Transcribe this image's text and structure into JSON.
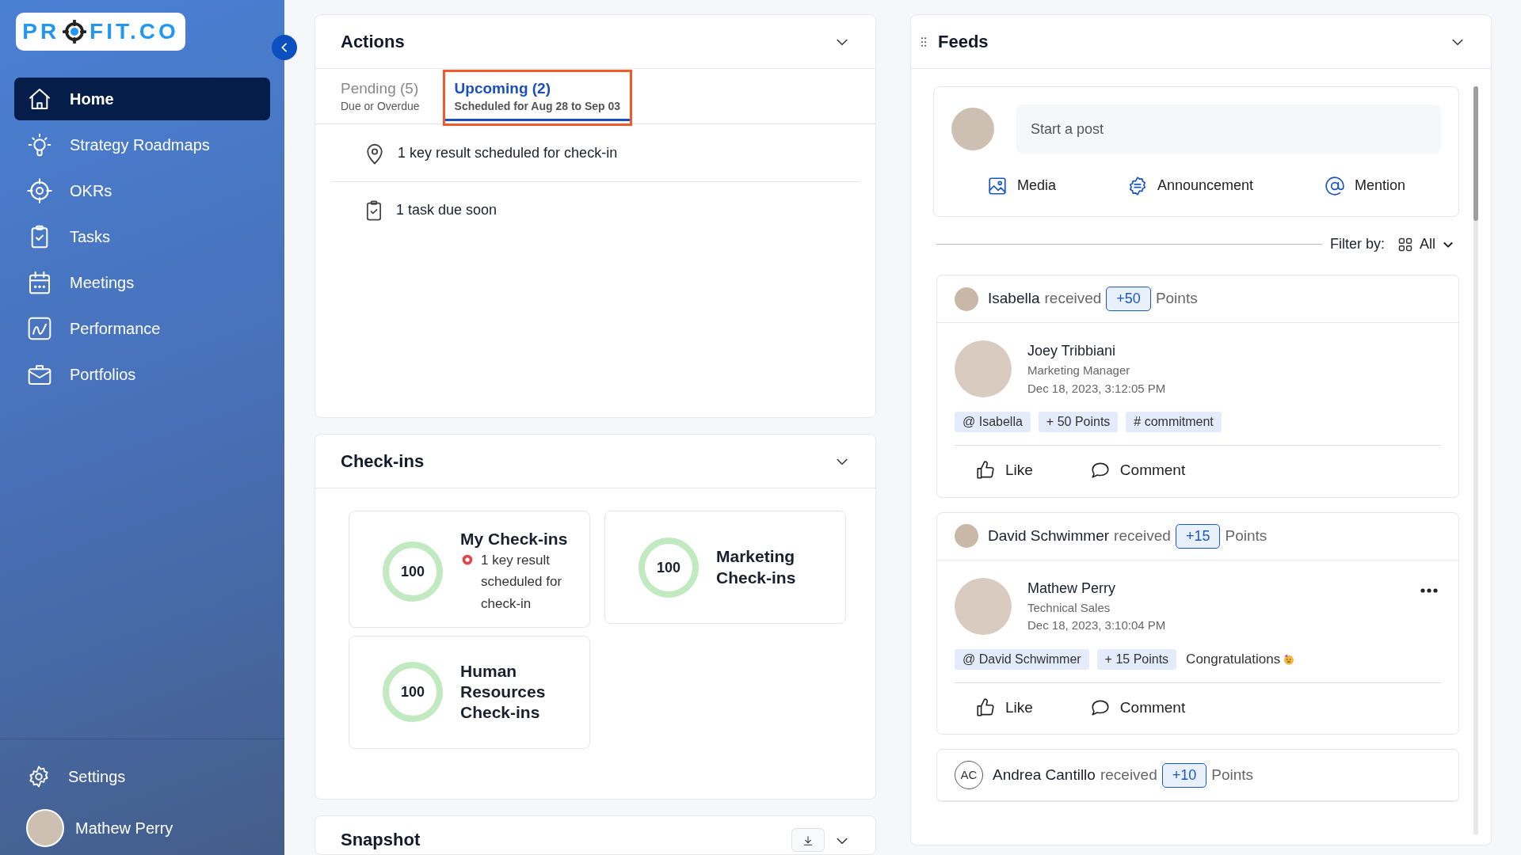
{
  "sidebar": {
    "logo": {
      "before": "PR",
      "after": "FIT.CO"
    },
    "items": [
      {
        "label": "Home",
        "kind": "home",
        "selected": true
      },
      {
        "label": "Strategy Roadmaps",
        "kind": "bulb",
        "selected": false
      },
      {
        "label": "OKRs",
        "kind": "target",
        "selected": false
      },
      {
        "label": "Tasks",
        "kind": "clipboard",
        "selected": false
      },
      {
        "label": "Meetings",
        "kind": "calendar",
        "selected": false
      },
      {
        "label": "Performance",
        "kind": "chart",
        "selected": false
      },
      {
        "label": "Portfolios",
        "kind": "briefcase",
        "selected": false
      }
    ],
    "settings": "Settings",
    "user": "Mathew Perry"
  },
  "actions": {
    "title": "Actions",
    "tabs": [
      {
        "label": "Pending (5)",
        "sub": "Due or Overdue",
        "selected": false
      },
      {
        "label": "Upcoming (2)",
        "sub": "Scheduled for Aug 28 to Sep 03",
        "selected": true
      }
    ],
    "items": [
      {
        "kind": "pin",
        "text": "1 key result scheduled for check-in"
      },
      {
        "kind": "task",
        "text": "1 task due soon"
      }
    ]
  },
  "checkins": {
    "title": "Check-ins",
    "cards": [
      {
        "score": "100",
        "level": 1,
        "title": "My Check-ins",
        "note": "1 key result scheduled for check-in"
      },
      {
        "score": "100",
        "level": 1,
        "title": "Marketing Check-ins"
      },
      {
        "score": "100",
        "level": 1,
        "title": "Human Resources Check-ins"
      }
    ]
  },
  "snapshot": {
    "title": "Snapshot"
  },
  "feeds": {
    "title": "Feeds",
    "placeholder": "Start a post",
    "composer_actions": [
      {
        "kind": "media",
        "label": "Media"
      },
      {
        "kind": "announcement",
        "label": "Announcement"
      },
      {
        "kind": "mention",
        "label": "Mention"
      }
    ],
    "filter": {
      "label": "Filter by:",
      "value": "All"
    },
    "posts": [
      {
        "recipient": "Isabella",
        "verb": "received",
        "points": "+50",
        "unit": "Points",
        "author": "Joey Tribbiani",
        "role": "Marketing Manager",
        "time": "Dec 18, 2023, 3:12:05 PM",
        "more_menu": false,
        "tags": [
          "@ Isabella",
          "+ 50 Points",
          "# commitment"
        ],
        "like": "Like",
        "comment": "Comment"
      },
      {
        "recipient": "David Schwimmer",
        "verb": "received",
        "points": "+15",
        "unit": "Points",
        "author": "Mathew Perry",
        "role": "Technical Sales",
        "time": "Dec 18, 2023, 3:10:04 PM",
        "more_menu": true,
        "tags": [
          "@ David Schwimmer",
          "+ 15 Points"
        ],
        "message": "Congratulations",
        "emoji": true,
        "like": "Like",
        "comment": "Comment"
      },
      {
        "recipient": "Andrea Cantillo",
        "verb": "received",
        "points": "+10",
        "unit": "Points",
        "initials": "AC"
      }
    ]
  }
}
